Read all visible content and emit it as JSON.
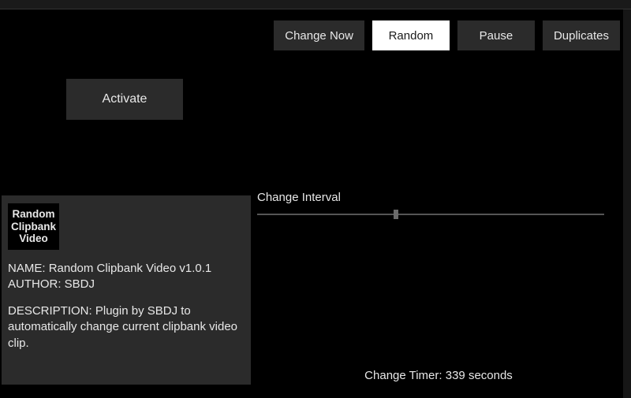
{
  "toolbar": {
    "change_now": "Change Now",
    "random": "Random",
    "pause": "Pause",
    "duplicates": "Duplicates",
    "selected": "random"
  },
  "activate": {
    "label": "Activate"
  },
  "plugin": {
    "badge_line1": "Random",
    "badge_line2": "Clipbank",
    "badge_line3": "Video",
    "name_label": "NAME:",
    "name_value": "Random Clipbank Video v1.0.1",
    "author_label": "AUTHOR:",
    "author_value": "SBDJ",
    "description_label": "DESCRIPTION:",
    "description_value": "Plugin by SBDJ to automatically change current clipbank video clip."
  },
  "interval": {
    "label": "Change Interval",
    "value_pct": 40
  },
  "timer": {
    "prefix": "Change Timer:",
    "value": 339,
    "unit": "seconds"
  }
}
